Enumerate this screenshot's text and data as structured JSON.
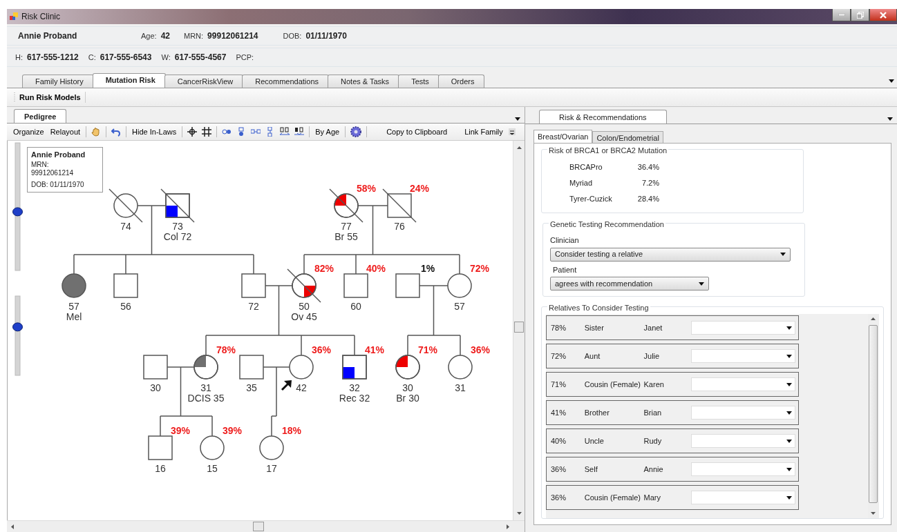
{
  "window": {
    "title": "Risk Clinic"
  },
  "patient": {
    "name": "Annie Proband",
    "fields": [
      {
        "label": "Age:",
        "value": "42"
      },
      {
        "label": "MRN:",
        "value": "99912061214"
      },
      {
        "label": "DOB:",
        "value": "01/11/1970"
      }
    ],
    "phones": [
      {
        "label": "H:",
        "value": "617-555-1212"
      },
      {
        "label": "C:",
        "value": "617-555-6543"
      },
      {
        "label": "W:",
        "value": "617-555-4567"
      }
    ],
    "pcp_label": "PCP:"
  },
  "tabs": [
    {
      "label": "Family History",
      "selected": false
    },
    {
      "label": "Mutation Risk",
      "selected": true
    },
    {
      "label": "CancerRiskView",
      "selected": false
    },
    {
      "label": "Recommendations",
      "selected": false
    },
    {
      "label": "Notes & Tasks",
      "selected": false
    },
    {
      "label": "Tests",
      "selected": false
    },
    {
      "label": "Orders",
      "selected": false
    }
  ],
  "toolbar": {
    "button": "Run Risk Models"
  },
  "pedigree": {
    "tab": {
      "label": "Pedigree",
      "selected": true
    },
    "toolbar": [
      "Organize",
      "Relayout",
      "Hide In-Laws",
      "By Age",
      "Copy to Clipboard",
      "Link Family"
    ],
    "info_box": {
      "name": "Annie Proband",
      "mrn_label": "MRN:",
      "mrn": "99912061214",
      "dob": "DOB: 01/11/1970"
    },
    "zoom_sliders": [
      {
        "level": 0.46
      },
      {
        "level": 0.61
      }
    ],
    "individuals": [
      {
        "kind": "female",
        "deceased": true,
        "age": "74"
      },
      {
        "kind": "male",
        "deceased": true,
        "age": "73",
        "diagnosis": "Col 72",
        "marker": {
          "kind": "sw",
          "color": "#0000ff"
        }
      },
      {
        "kind": "female",
        "deceased": true,
        "age": "77",
        "diagnosis": "Br 55",
        "risk": {
          "text": "58%",
          "color": "#ee1c1c"
        },
        "marker": {
          "kind": "nw",
          "color": "#ee0000"
        }
      },
      {
        "kind": "male",
        "deceased": true,
        "age": "76",
        "risk": {
          "text": "24%",
          "color": "#ee1c1c"
        }
      },
      {
        "kind": "female",
        "deceased": false,
        "age": "57",
        "diagnosis": "Mel",
        "marker": {
          "kind": "full",
          "color": "#707070"
        }
      },
      {
        "kind": "male",
        "deceased": false,
        "age": "56"
      },
      {
        "kind": "male",
        "deceased": false,
        "age": "72"
      },
      {
        "kind": "female",
        "deceased": true,
        "age": "50",
        "diagnosis": "Ov 45",
        "risk": {
          "text": "82%",
          "color": "#ee1c1c"
        },
        "marker": {
          "kind": "se",
          "color": "#ee0000"
        }
      },
      {
        "kind": "male",
        "deceased": false,
        "age": "60",
        "risk": {
          "text": "40%",
          "color": "#ee1c1c"
        }
      },
      {
        "kind": "male",
        "deceased": false,
        "risk": {
          "text": "1%",
          "color": "#111111"
        }
      },
      {
        "kind": "female",
        "deceased": false,
        "age": "57",
        "risk": {
          "text": "72%",
          "color": "#ee1c1c"
        }
      },
      {
        "kind": "male",
        "deceased": false,
        "age": "30"
      },
      {
        "kind": "female",
        "deceased": false,
        "age": "31",
        "diagnosis": "DCIS 35",
        "risk": {
          "text": "78%",
          "color": "#ee1c1c"
        },
        "marker": {
          "kind": "nw",
          "color": "#707070"
        }
      },
      {
        "kind": "male",
        "deceased": false,
        "age": "35"
      },
      {
        "kind": "female",
        "deceased": false,
        "age": "42",
        "proband": true,
        "risk": {
          "text": "36%",
          "color": "#ee1c1c"
        }
      },
      {
        "kind": "male",
        "deceased": false,
        "age": "32",
        "diagnosis": "Rec 32",
        "risk": {
          "text": "41%",
          "color": "#ee1c1c"
        },
        "marker": {
          "kind": "sw",
          "color": "#0000ff"
        }
      },
      {
        "kind": "female",
        "deceased": false,
        "age": "30",
        "diagnosis": "Br 30",
        "risk": {
          "text": "71%",
          "color": "#ee1c1c"
        },
        "marker": {
          "kind": "nw",
          "color": "#ee0000"
        }
      },
      {
        "kind": "female",
        "deceased": false,
        "age": "31",
        "risk": {
          "text": "36%",
          "color": "#ee1c1c"
        }
      },
      {
        "kind": "male",
        "deceased": false,
        "age": "16",
        "risk": {
          "text": "39%",
          "color": "#ee1c1c"
        }
      },
      {
        "kind": "female",
        "deceased": false,
        "age": "15",
        "risk": {
          "text": "39%",
          "color": "#ee1c1c"
        }
      },
      {
        "kind": "female",
        "deceased": false,
        "age": "17",
        "risk": {
          "text": "18%",
          "color": "#ee1c1c"
        }
      }
    ]
  },
  "risk_panel": {
    "tab": {
      "label": "Risk & Recommendations",
      "selected": true
    },
    "subtabs": [
      {
        "label": "Breast/Ovarian",
        "selected": true
      },
      {
        "label": "Colon/Endometrial",
        "selected": false
      }
    ],
    "mutation_risk": {
      "title": "Risk of BRCA1 or BRCA2 Mutation",
      "models": [
        {
          "name": "BRCAPro",
          "value": "36.4%"
        },
        {
          "name": "Myriad",
          "value": "7.2%"
        },
        {
          "name": "Tyrer-Cuzick",
          "value": "28.4%"
        }
      ]
    },
    "recommendation": {
      "title": "Genetic Testing Recommendation",
      "clinician_label": "Clinician",
      "clinician_value": "Consider testing a relative",
      "patient_label": "Patient",
      "patient_value": "agrees with recommendation"
    },
    "relatives": {
      "title": "Relatives To Consider Testing",
      "rows": [
        {
          "risk": "78%",
          "relation": "Sister",
          "name": "Janet"
        },
        {
          "risk": "72%",
          "relation": "Aunt",
          "name": "Julie"
        },
        {
          "risk": "71%",
          "relation": "Cousin (Female)",
          "name": "Karen"
        },
        {
          "risk": "41%",
          "relation": "Brother",
          "name": "Brian"
        },
        {
          "risk": "40%",
          "relation": "Uncle",
          "name": "Rudy"
        },
        {
          "risk": "36%",
          "relation": "Self",
          "name": "Annie"
        },
        {
          "risk": "36%",
          "relation": "Cousin (Female)",
          "name": "Mary"
        }
      ]
    }
  }
}
